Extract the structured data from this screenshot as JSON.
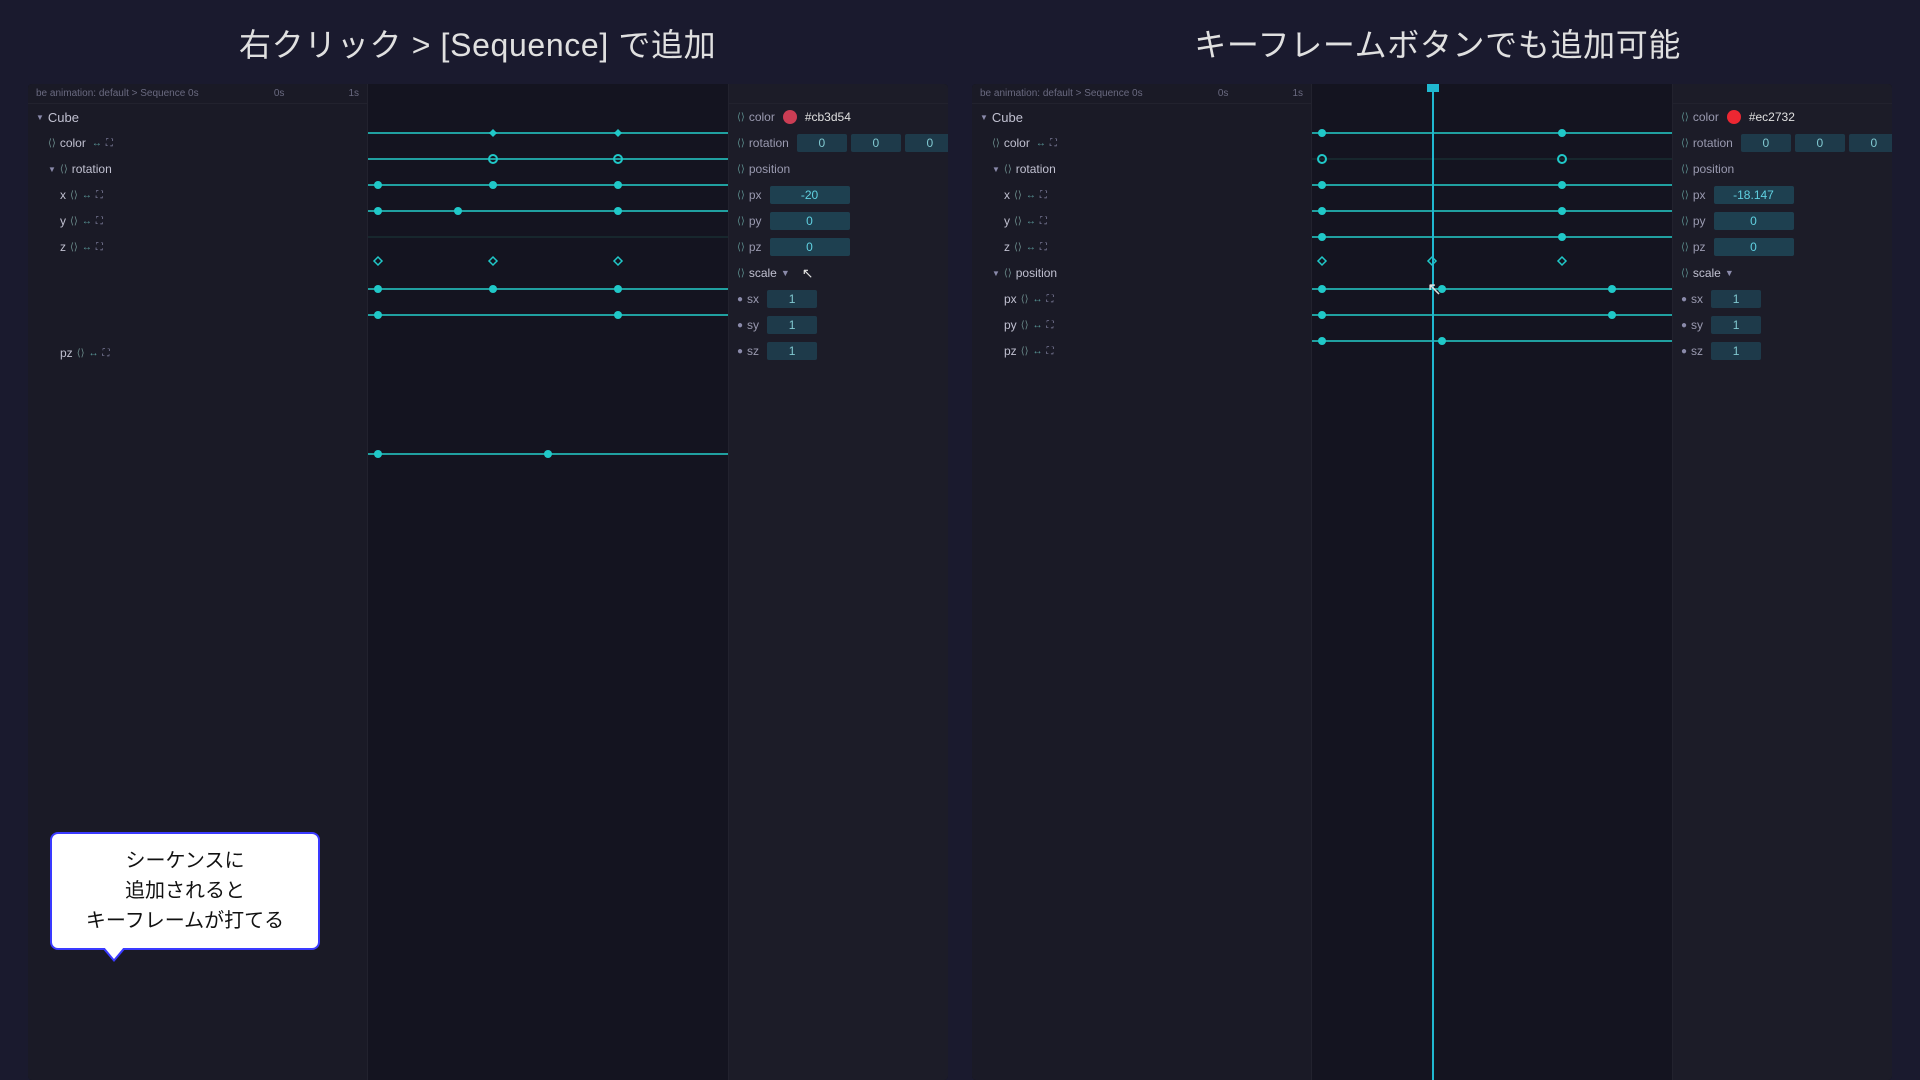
{
  "page": {
    "bg_color": "#1a1a2e",
    "title_left": "右クリック > [Sequence] で追加",
    "title_right": "キーフレームボタンでも追加可能"
  },
  "left_panel": {
    "breadcrumb": "be animation: default > Sequence 0s",
    "ruler_label_0": "0s",
    "ruler_label_1": "1s",
    "cube_label": "Cube",
    "color_label": "color",
    "color_dot": "#cb3d54",
    "color_hex": "#cb3d54",
    "rotation_label": "rotation",
    "x_label": "x",
    "y_label": "y",
    "z_label": "z",
    "position_label": "position",
    "px_label": "px",
    "px_value": "-20",
    "py_label": "py",
    "py_value": "0",
    "pz_label": "pz",
    "pz_value": "0",
    "scale_label": "scale",
    "sx_label": "sx",
    "sx_value": "1",
    "sy_label": "sy",
    "sy_value": "1",
    "sz_label": "sz",
    "sz_value": "1",
    "rotation_x": "0",
    "rotation_y": "0",
    "rotation_z": "0"
  },
  "right_panel": {
    "breadcrumb": "be animation: default > Sequence 0s",
    "ruler_label_0": "0s",
    "ruler_label_1": "1s",
    "cube_label": "Cube",
    "color_label": "color",
    "color_dot": "#ec2732",
    "color_hex": "#ec2732",
    "rotation_label": "rotation",
    "x_label": "x",
    "y_label": "y",
    "z_label": "z",
    "position_label": "position",
    "px_label": "px",
    "px_value": "-18.147",
    "py_label": "py",
    "py_value": "0",
    "pz_label": "pz",
    "pz_value": "0",
    "scale_label": "scale",
    "sx_label": "sx",
    "sx_value": "1",
    "sy_label": "sy",
    "sy_value": "1",
    "sz_label": "sz",
    "sz_value": "1",
    "rotation_x": "0",
    "rotation_y": "0",
    "rotation_z": "0"
  },
  "callout": {
    "line1": "シーケンスに",
    "line2": "追加されると",
    "line3": "キーフレームが打てる"
  }
}
